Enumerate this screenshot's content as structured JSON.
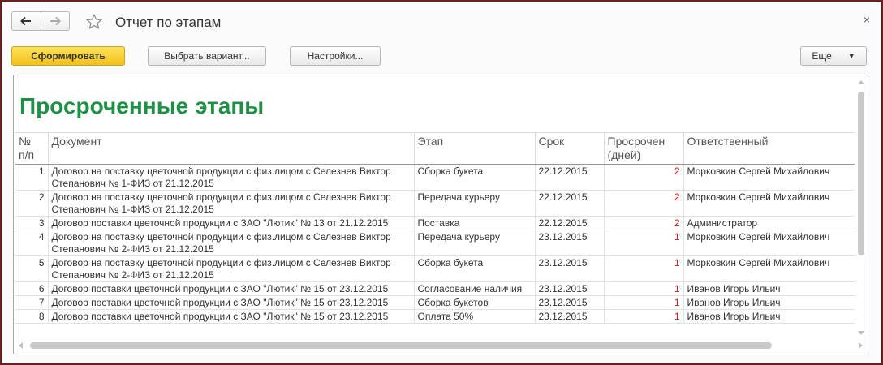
{
  "window": {
    "title": "Отчет по этапам",
    "close_symbol": "×"
  },
  "toolbar": {
    "generate_label": "Сформировать",
    "variant_label": "Выбрать вариант...",
    "settings_label": "Настройки...",
    "more_label": "Еще",
    "more_caret": "▼"
  },
  "report": {
    "title": "Просроченные этапы",
    "title_color": "#1f9146",
    "overdue_color": "#c21d1d",
    "columns": {
      "num": "№\nп/п",
      "document": "Документ",
      "stage": "Этап",
      "deadline": "Срок",
      "overdue": "Просрочен\n(дней)",
      "responsible": "Ответственный"
    },
    "rows": [
      {
        "num": "1",
        "document": "Договор на поставку цветочной продукции с физ.лицом с Селезнев Виктор Степанович № 1-ФИЗ от 21.12.2015",
        "stage": "Сборка букета",
        "deadline": "22.12.2015",
        "overdue": "2",
        "responsible": "Морковкин Сергей Михайлович"
      },
      {
        "num": "2",
        "document": "Договор на поставку цветочной продукции с физ.лицом с Селезнев Виктор Степанович № 1-ФИЗ от 21.12.2015",
        "stage": "Передача курьеру",
        "deadline": "22.12.2015",
        "overdue": "2",
        "responsible": "Морковкин Сергей Михайлович"
      },
      {
        "num": "3",
        "document": "Договор поставки цветочной продукции с ЗАО \"Лютик\" № 13 от 21.12.2015",
        "stage": "Поставка",
        "deadline": "22.12.2015",
        "overdue": "2",
        "responsible": "Администратор"
      },
      {
        "num": "4",
        "document": "Договор на поставку цветочной продукции с физ.лицом с Селезнев Виктор Степанович № 2-ФИЗ от 21.12.2015",
        "stage": "Передача курьеру",
        "deadline": "23.12.2015",
        "overdue": "1",
        "responsible": "Морковкин Сергей Михайлович"
      },
      {
        "num": "5",
        "document": "Договор на поставку цветочной продукции с физ.лицом с Селезнев Виктор Степанович № 2-ФИЗ от 21.12.2015",
        "stage": "Сборка букета",
        "deadline": "23.12.2015",
        "overdue": "1",
        "responsible": "Морковкин Сергей Михайлович"
      },
      {
        "num": "6",
        "document": "Договор поставки цветочной продукции с ЗАО \"Лютик\" № 15 от 23.12.2015",
        "stage": "Согласование наличия",
        "deadline": "23.12.2015",
        "overdue": "1",
        "responsible": "Иванов Игорь Ильич"
      },
      {
        "num": "7",
        "document": "Договор поставки цветочной продукции с ЗАО \"Лютик\" № 15 от 23.12.2015",
        "stage": "Сборка букетов",
        "deadline": "23.12.2015",
        "overdue": "1",
        "responsible": "Иванов Игорь Ильич"
      },
      {
        "num": "8",
        "document": "Договор поставки цветочной продукции с ЗАО \"Лютик\" № 15 от 23.12.2015",
        "stage": "Оплата 50%",
        "deadline": "23.12.2015",
        "overdue": "1",
        "responsible": "Иванов Игорь Ильич"
      }
    ]
  }
}
